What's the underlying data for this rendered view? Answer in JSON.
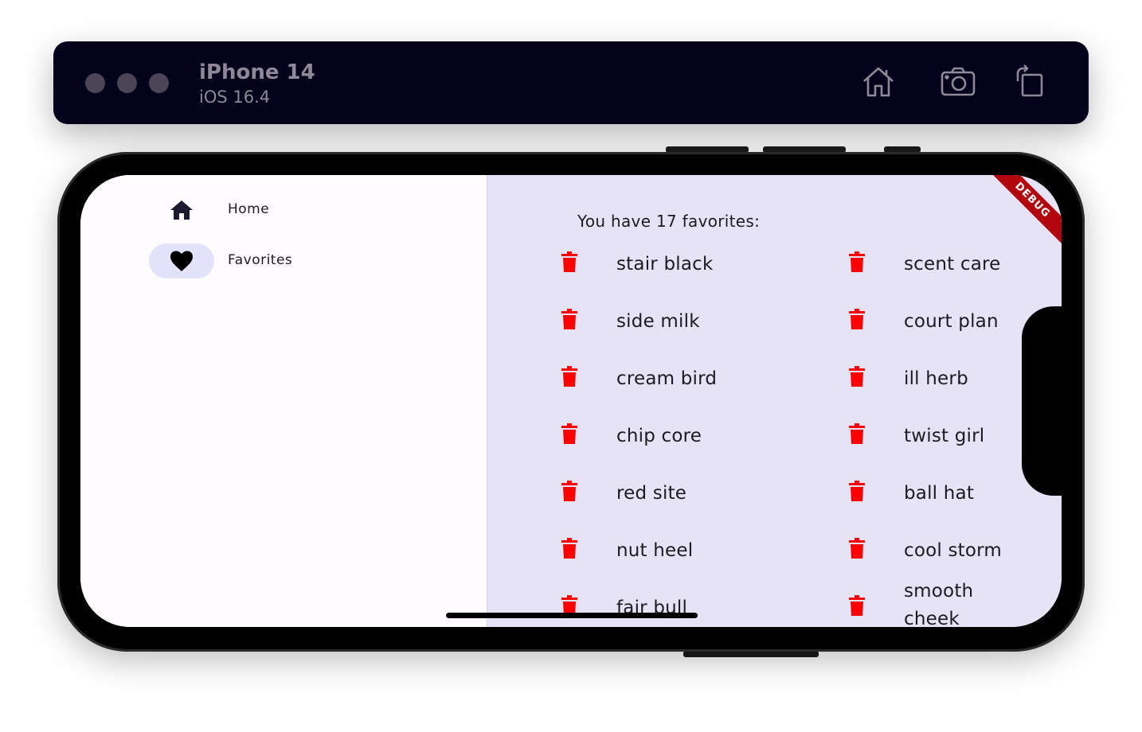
{
  "simulator": {
    "device_name": "iPhone 14",
    "os_version": "iOS 16.4",
    "toolbar_icons": [
      "home-icon",
      "screenshot-icon",
      "rotate-icon"
    ]
  },
  "nav": {
    "items": [
      {
        "label": "Home",
        "icon": "home-icon",
        "selected": false
      },
      {
        "label": "Favorites",
        "icon": "heart-icon",
        "selected": true
      }
    ]
  },
  "favorites": {
    "header": "You have 17 favorites:",
    "items": [
      "stair black",
      "scent care",
      "side milk",
      "court plan",
      "cream bird",
      "ill herb",
      "chip core",
      "twist girl",
      "red site",
      "ball hat",
      "nut heel",
      "cool storm",
      "fair bull",
      "smooth cheek"
    ]
  },
  "banner": {
    "debug_label": "DEBUG"
  },
  "colors": {
    "content_bg": "#e6e3f7",
    "rail_selected": "#e3e2fb",
    "trash": "#ff0000",
    "debug_banner": "#b2060e",
    "toolbar_bg": "#03021a"
  }
}
